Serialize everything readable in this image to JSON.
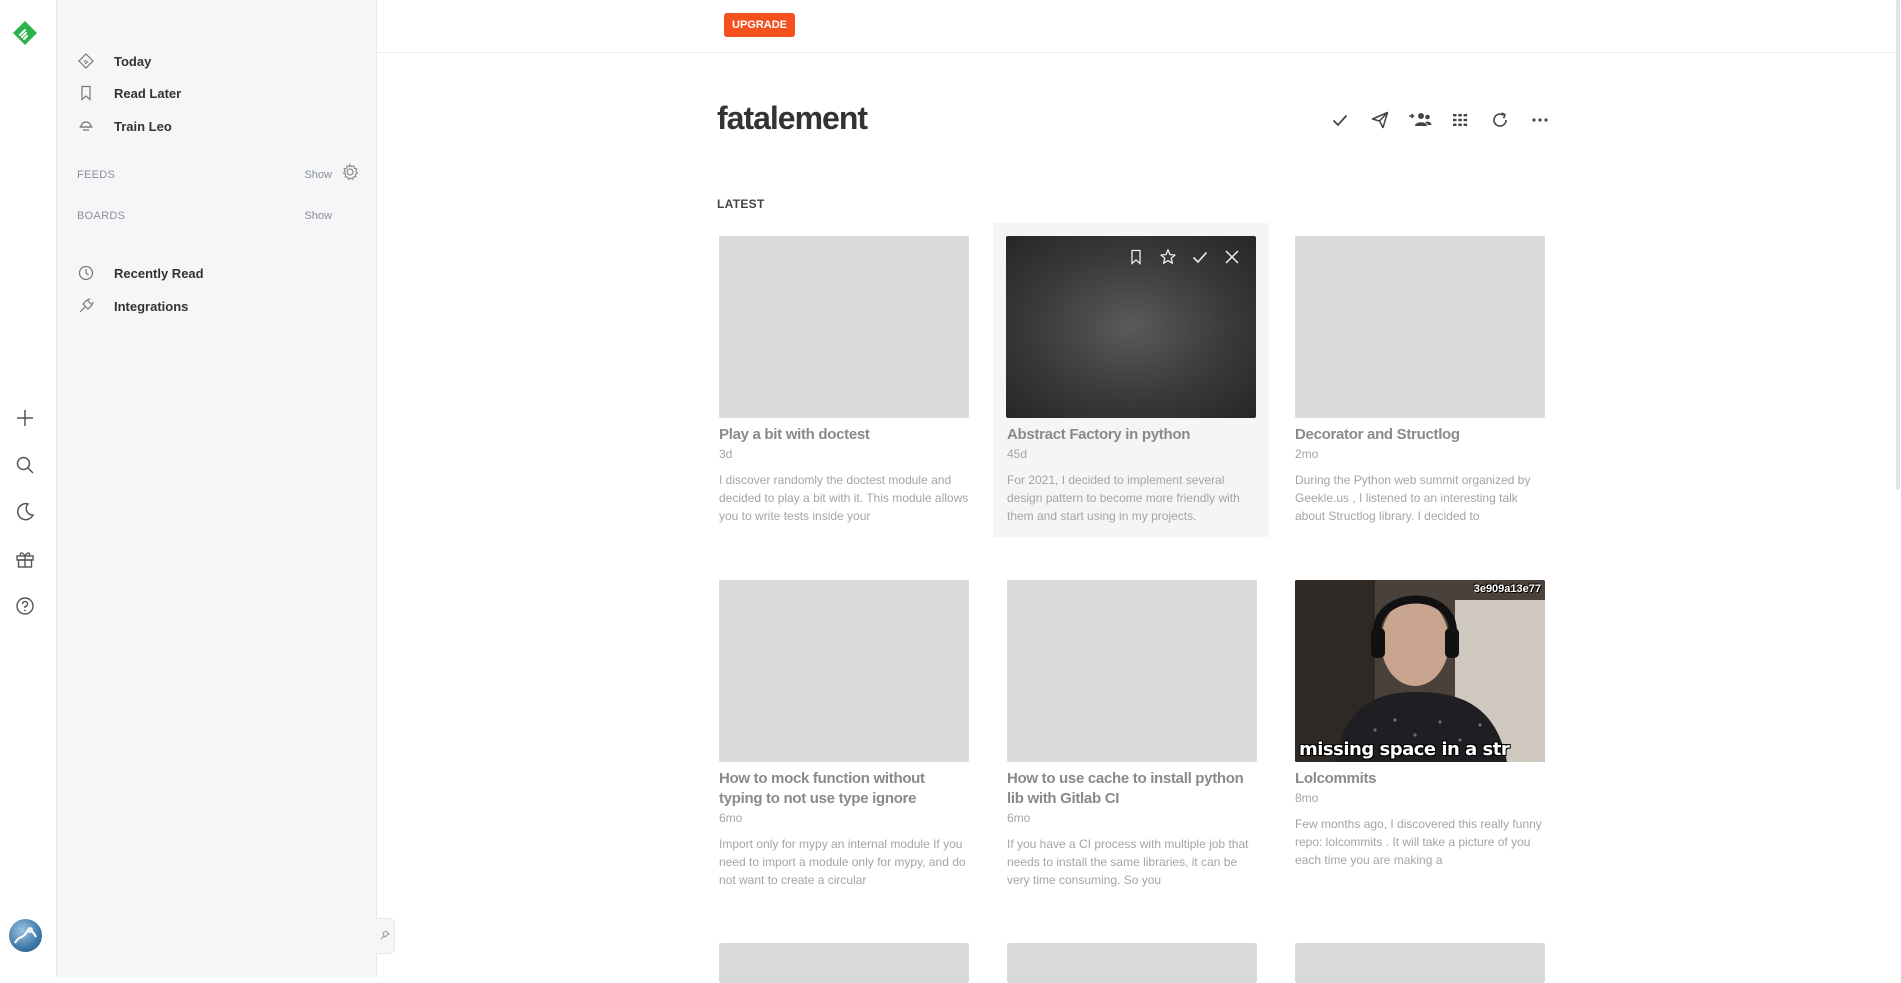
{
  "topbar": {
    "upgrade_label": "UPGRADE"
  },
  "rail": {
    "icons": [
      "feedly-logo-icon",
      "plus-icon",
      "search-icon",
      "moon-icon",
      "gift-icon",
      "help-icon"
    ]
  },
  "sidebar": {
    "top_items": [
      {
        "label": "Today",
        "icon": "today-icon"
      },
      {
        "label": "Read Later",
        "icon": "bookmark-icon"
      },
      {
        "label": "Train Leo",
        "icon": "leo-icon"
      }
    ],
    "feeds": {
      "title": "FEEDS",
      "show_label": "Show"
    },
    "boards": {
      "title": "BOARDS",
      "show_label": "Show"
    },
    "bottom_items": [
      {
        "label": "Recently Read",
        "icon": "clock-icon"
      },
      {
        "label": "Integrations",
        "icon": "plug-icon"
      }
    ]
  },
  "main": {
    "title": "fatalement",
    "section_label": "LATEST",
    "toolbar": [
      "check-icon",
      "send-icon",
      "follow-icon",
      "grid-icon",
      "refresh-icon",
      "more-icon"
    ],
    "articles": [
      {
        "title": "Play a bit with doctest",
        "age": "3d",
        "excerpt": "I discover randomly the doctest module and decided to play a bit with it. This module allows you to write tests inside your"
      },
      {
        "title": "Abstract Factory in python",
        "age": "45d",
        "excerpt": "For 2021, I decided to implement several design pattern to become more friendly with them and start using in my projects."
      },
      {
        "title": "Decorator and Structlog",
        "age": "2mo",
        "excerpt": "During the Python web summit organized by Geekle.us , I listened to an interesting talk about Structlog library. I decided to"
      },
      {
        "title": "How to mock function without typing to not use type ignore",
        "age": "6mo",
        "excerpt": "Import only for mypy an internal module If you need to import a module only for mypy, and do not want to create a circular"
      },
      {
        "title": "How to use cache to install python lib with Gitlab CI",
        "age": "6mo",
        "excerpt": "If you have a CI process with multiple job that needs to install the same libraries, it can be very time consuming. So you"
      },
      {
        "title": "Lolcommits",
        "age": "8mo",
        "excerpt": "Few months ago, I discovered this really funny repo: lolcommits . It will take a picture of you each time you are making a",
        "photo_caption": "missing space in a str",
        "photo_hash": "3e909a13e77"
      }
    ]
  }
}
